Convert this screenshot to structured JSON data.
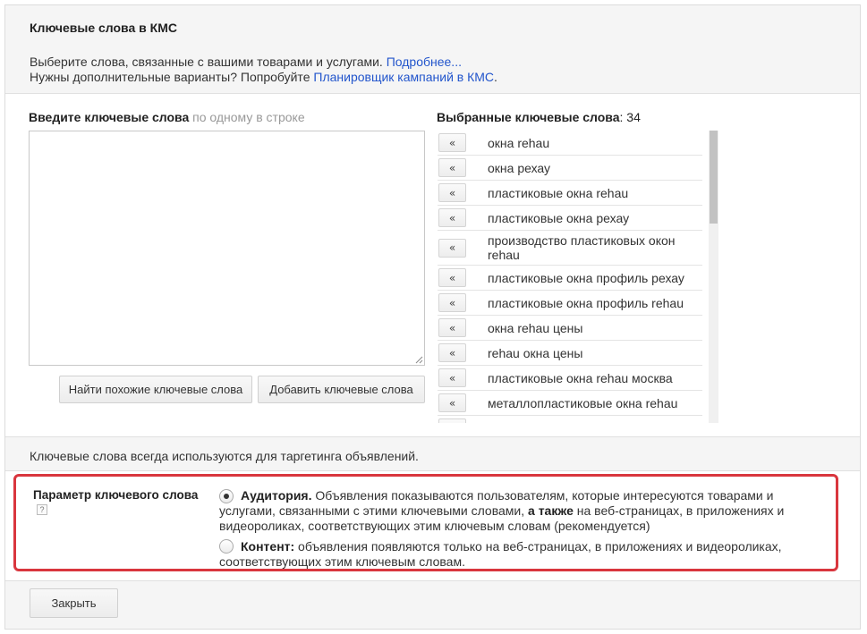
{
  "header": {
    "title": "Ключевые слова в КМС",
    "desc_line1": "Выберите слова, связанные с вашими товарами и услугами. ",
    "desc_link1": "Подробнее...",
    "desc_line2": "Нужны дополнительные варианты? Попробуйте ",
    "desc_link2": "Планировщик кампаний в КМС",
    "desc_line2_end": "."
  },
  "input": {
    "label_bold": "Введите ключевые слова",
    "label_hint": " по одному в строке",
    "value": ""
  },
  "buttons": {
    "find_similar": "Найти похожие ключевые слова",
    "add_keywords": "Добавить ключевые слова",
    "close": "Закрыть"
  },
  "selected": {
    "label_bold": "Выбранные ключевые слова",
    "label_count": ": 34",
    "remove_symbol": "«",
    "items": [
      "окна rehau",
      "окна рехау",
      "пластиковые окна rehau",
      "пластиковые окна рехау",
      "производство пластиковых окон rehau",
      "пластиковые окна профиль рехау",
      "пластиковые окна профиль rehau",
      "окна rehau цены",
      "rehau окна цены",
      "пластиковые окна rehau москва",
      "металлопластиковые окна rehau",
      ""
    ]
  },
  "note": "Ключевые слова всегда используются для таргетинга объявлений.",
  "param": {
    "label": "Параметр ключевого слова",
    "help": "?",
    "audience_title": "Аудитория.",
    "audience_text1": " Объявления показываются пользователям, которые интересуются товарами и услугами, связанными с этими ключевыми словами, ",
    "audience_bold2": "а также",
    "audience_text2": " на веб-страницах, в приложениях и видеороликах, соответствующих этим ключевым словам (рекомендуется)",
    "content_title": "Контент:",
    "content_text": " объявления появляются только на веб-страницах, в приложениях и видеороликах, соответствующих этим ключевым словам.",
    "selected": "audience"
  },
  "colors": {
    "link": "#2255cc",
    "highlight": "#d9363e",
    "panel_bg": "#f5f5f5"
  }
}
